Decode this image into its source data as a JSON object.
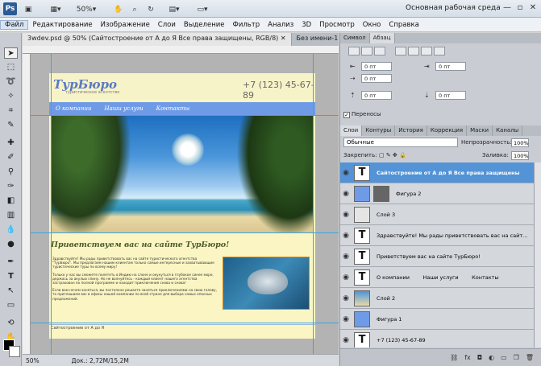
{
  "appbar": {
    "logo": "Ps",
    "zoom": "50%",
    "workspace": "Основная рабочая среда",
    "winbtns": [
      "—",
      "▫",
      "✕"
    ]
  },
  "menu": [
    "Файл",
    "Редактирование",
    "Изображение",
    "Слои",
    "Выделение",
    "Фильтр",
    "Анализ",
    "3D",
    "Просмотр",
    "Окно",
    "Справка"
  ],
  "doc_tabs": [
    {
      "label": "3wdev.psd @ 50% (Сайтостроение от А до Я Все права защищены, RGB/8) ✕",
      "active": true
    },
    {
      "label": "Без имени-1 ✕",
      "active": false
    }
  ],
  "site": {
    "logo": "ТурБюро",
    "logo_sub": "туристическое агентство",
    "phone": "+7 (123) 45-67-89",
    "nav": [
      "О компании",
      "Наши услуги",
      "Контакты"
    ],
    "welcome": "Приветствуем вас на сайте ТурБюро!",
    "paragraphs": [
      "Здравствуйте! Мы рады приветствовать вас на сайте туристического агентства \"ТурБюро\". Мы предлагаем нашим клиентам только самые интересные и захватывающие туристические туры по всему миру!",
      "Только у нас вы сможете полететь в Индию на слоне и окунуться в глубокое синее море, держась за акулью спину. Но не волнуйтесь - каждый клиент нашего агентства застрахован по полной программе и находит приключения снова и снова!",
      "Если вам нечем заняться, вы постоянно решаете заняться приключениями на свою голову, то приглашаем вас в офисы нашей компании по всей стране для выбора самых опасных предложений."
    ],
    "footer": "Сайтостроение от А до Я"
  },
  "status": {
    "zoom": "50%",
    "doc": "Док.: 2,72M/15,2M"
  },
  "paragraph_panel": {
    "tabs": [
      "Символ",
      "Абзац"
    ],
    "indents": [
      "0 пт",
      "0 пт",
      "0 пт",
      "0 пт",
      "0 пт"
    ],
    "hyphenation": "Переносы"
  },
  "layers_panel": {
    "tabs": [
      "Слои",
      "Контуры",
      "История",
      "Коррекция",
      "Маски",
      "Каналы"
    ],
    "blend_mode": "Обычные",
    "opacity_label": "Непрозрачность:",
    "opacity": "100%",
    "lock_label": "Закрепить:",
    "fill_label": "Заливка:",
    "fill": "100%",
    "layers": [
      {
        "name": "Сайтостроение от А до Я Все права защищены",
        "kind": "T",
        "selected": true
      },
      {
        "name": "Фигура 2",
        "kind": "shape",
        "selected": false
      },
      {
        "name": "Слой 3",
        "kind": "img",
        "selected": false
      },
      {
        "name": "Здравствуйте! Мы рады приветствовать вас на сайт...",
        "kind": "T",
        "selected": false
      },
      {
        "name": "Приветствуем вас на сайте ТурБюро!",
        "kind": "T",
        "selected": false
      },
      {
        "name": "О компании        Наши услуги        Контакты",
        "kind": "T",
        "selected": false
      },
      {
        "name": "Слой 2",
        "kind": "img",
        "selected": false
      },
      {
        "name": "Фигура 1",
        "kind": "shape",
        "selected": false
      },
      {
        "name": "+7 (123) 45-67-89",
        "kind": "T",
        "selected": false
      }
    ],
    "bottom_icons": [
      "link-icon",
      "fx-icon",
      "mask-icon",
      "adjustment-icon",
      "folder-icon",
      "new-layer-icon",
      "trash-icon"
    ]
  },
  "colors": {
    "accent": "#5393d6",
    "nav": "#6f9be6"
  }
}
